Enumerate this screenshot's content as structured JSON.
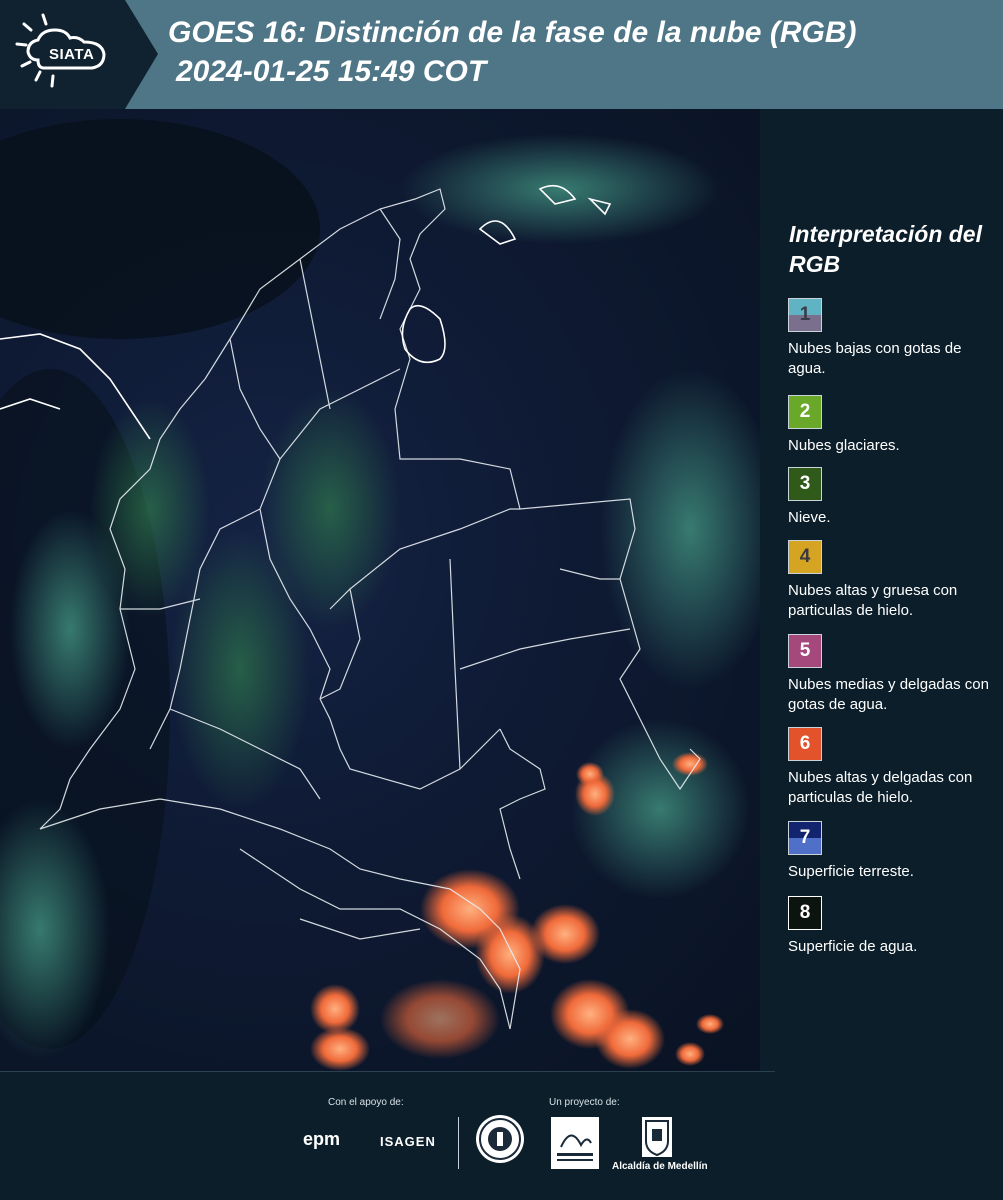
{
  "header": {
    "logo_text": "SIATA",
    "title_line1": "GOES 16: Distinción de la fase de la nube (RGB)",
    "title_line2": "2024-01-25 15:49 COT"
  },
  "legend": {
    "title": "Interpretación del RGB",
    "items": [
      {
        "num": "1",
        "label": "Nubes bajas con gotas de agua.",
        "color_top": "#5fb3c3",
        "color_bottom": "#7a6f8c",
        "num_color": "#3a3a4a"
      },
      {
        "num": "2",
        "label": "Nubes glaciares.",
        "color_top": "#6aa829",
        "color_bottom": "#6aa829",
        "num_color": "#ffffff"
      },
      {
        "num": "3",
        "label": "Nieve.",
        "color_top": "#2f5a19",
        "color_bottom": "#2f5a19",
        "num_color": "#ffffff"
      },
      {
        "num": "4",
        "label": "Nubes altas y gruesa con particulas de hielo.",
        "color_top": "#d6a423",
        "color_bottom": "#d6a423",
        "num_color": "#3a3a3a"
      },
      {
        "num": "5",
        "label": "Nubes medias y delgadas con gotas de agua.",
        "color_top": "#a5497c",
        "color_bottom": "#a5497c",
        "num_color": "#ffffff"
      },
      {
        "num": "6",
        "label": "Nubes altas y delgadas con particulas de hielo.",
        "color_top": "#e2532b",
        "color_bottom": "#e2532b",
        "num_color": "#ffffff"
      },
      {
        "num": "7",
        "label": "Superficie terreste.",
        "color_top": "#13246e",
        "color_bottom": "#4f6fc8",
        "num_color": "#ffffff"
      },
      {
        "num": "8",
        "label": "Superficie de agua.",
        "color_top": "#0c1410",
        "color_bottom": "#0c1410",
        "num_color": "#ffffff"
      }
    ]
  },
  "footer": {
    "support_label": "Con el apoyo de:",
    "project_label": "Un proyecto de:",
    "epm": "epm",
    "isagen": "ISAGEN",
    "alcaldia": "Alcaldía de Medellín"
  }
}
